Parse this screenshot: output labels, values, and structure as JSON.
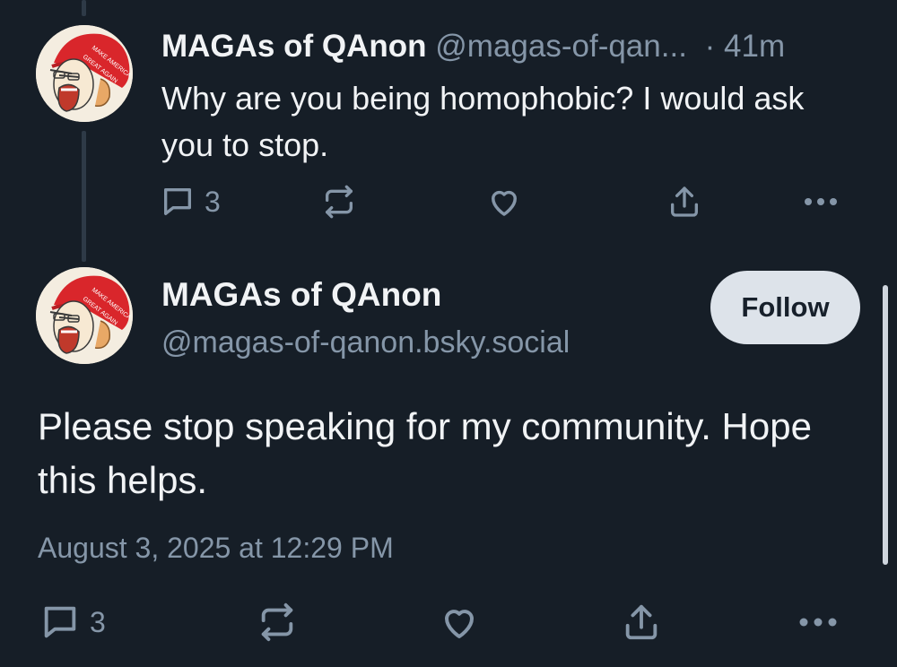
{
  "parent_post": {
    "author_name": "MAGAs of QAnon",
    "author_handle": "@magas-of-qan...",
    "separator": "·",
    "time_ago": "41m",
    "text": "Why are you being homophobic? I would ask you to stop.",
    "reply_count": "3",
    "avatar": {
      "hat_text_line1": "MAKE AMERICA",
      "hat_text_line2": "GREAT AGAIN"
    },
    "icons": [
      "reply-icon",
      "repost-icon",
      "like-icon",
      "share-icon",
      "more-icon"
    ]
  },
  "main_post": {
    "author_name": "MAGAs of QAnon",
    "author_handle": "@magas-of-qanon.bsky.social",
    "follow_label": "Follow",
    "text": "Please stop speaking for my community. Hope this helps.",
    "timestamp": "August 3, 2025 at 12:29 PM",
    "reply_count": "3",
    "avatar": {
      "hat_text_line1": "MAKE AMERICA",
      "hat_text_line2": "GREAT AGAIN"
    },
    "icons": [
      "reply-icon",
      "repost-icon",
      "like-icon",
      "share-icon",
      "more-icon"
    ]
  },
  "colors": {
    "background": "#161e27",
    "text": "#f1f3f5",
    "muted": "#8596a8",
    "follow_button_bg": "#dde3ea",
    "hat_red": "#d9262b"
  }
}
